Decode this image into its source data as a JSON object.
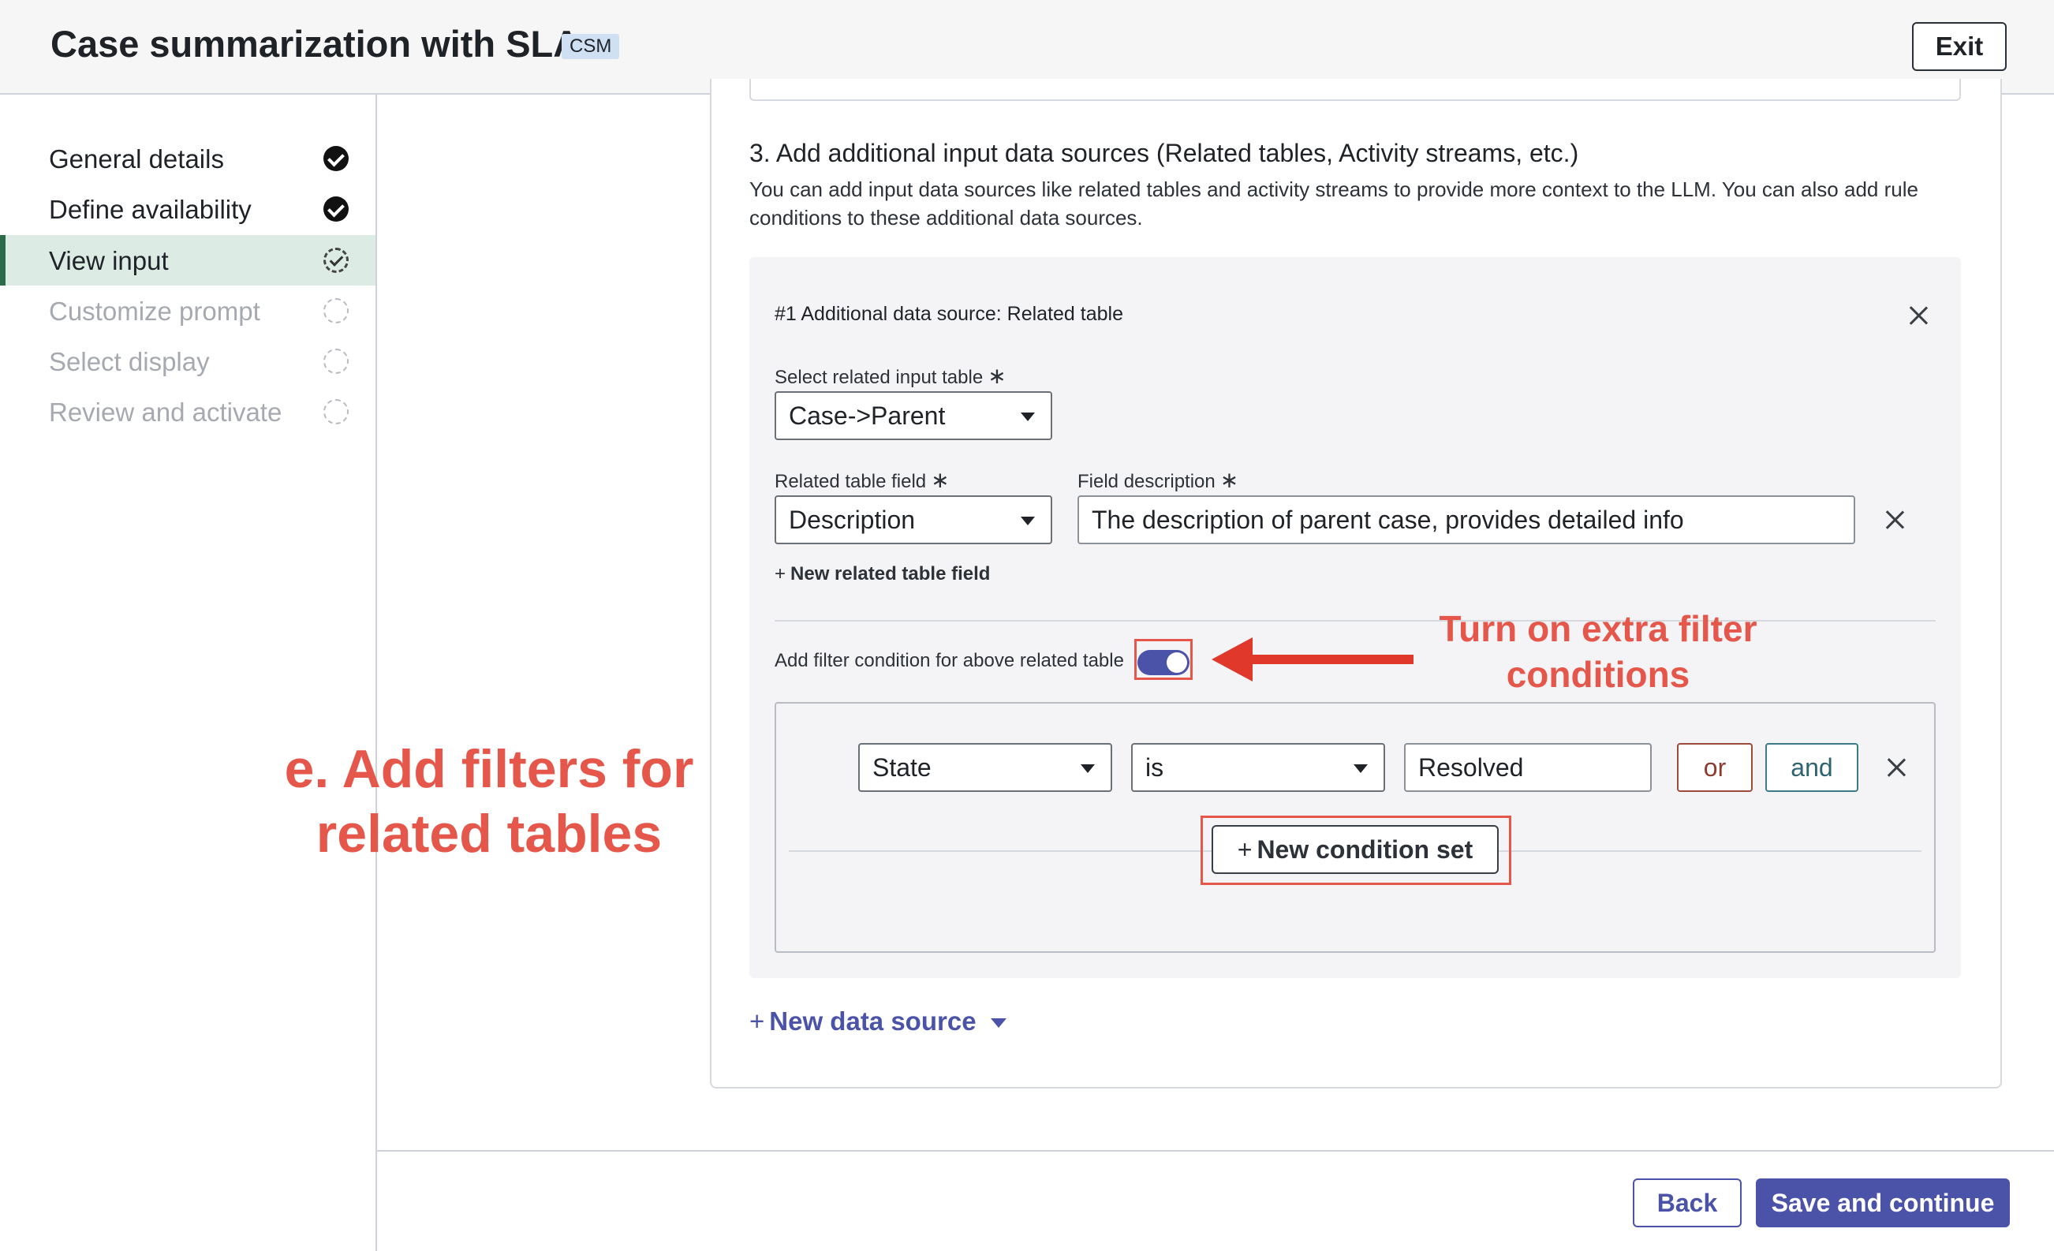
{
  "header": {
    "title": "Case summarization with SLA",
    "badge": "CSM",
    "exit_label": "Exit"
  },
  "sidebar": {
    "items": [
      {
        "label": "General details",
        "status": "complete"
      },
      {
        "label": "Define availability",
        "status": "complete"
      },
      {
        "label": "View input",
        "status": "in-progress"
      },
      {
        "label": "Customize prompt",
        "status": "not-started"
      },
      {
        "label": "Select display",
        "status": "not-started"
      },
      {
        "label": "Review and activate",
        "status": "not-started"
      }
    ]
  },
  "section": {
    "title": "3. Add additional input data sources (Related tables, Activity streams, etc.)",
    "description": "You can add input data sources like related tables and activity streams to provide more context to the LLM. You can also add rule conditions to these additional data sources."
  },
  "data_source": {
    "title": "#1 Additional data source: Related table",
    "related_input_table_label": "Select related input table",
    "related_input_table_value": "Case->Parent",
    "related_table_field_label": "Related table field",
    "related_table_field_value": "Description",
    "field_description_label": "Field description",
    "field_description_value": "The description of parent case, provides detailed info",
    "new_field_link": "New related table field",
    "required_mark": "∗",
    "filter_toggle_label": "Add filter condition for above related table",
    "filter_toggle_on": true
  },
  "condition": {
    "field": "State",
    "operator": "is",
    "value": "Resolved",
    "or_label": "or",
    "and_label": "and",
    "new_condition_set_label": "New condition set"
  },
  "new_data_source_label": "New data source",
  "footer": {
    "back_label": "Back",
    "save_label": "Save and continue"
  },
  "annotations": {
    "left": "e. Add filters for related tables",
    "right": "Turn on extra filter conditions",
    "color": "#e4574a"
  },
  "colors": {
    "primary": "#4a53a8",
    "active_nav_bg": "#dcece5",
    "active_nav_border": "#2c6b4a"
  }
}
